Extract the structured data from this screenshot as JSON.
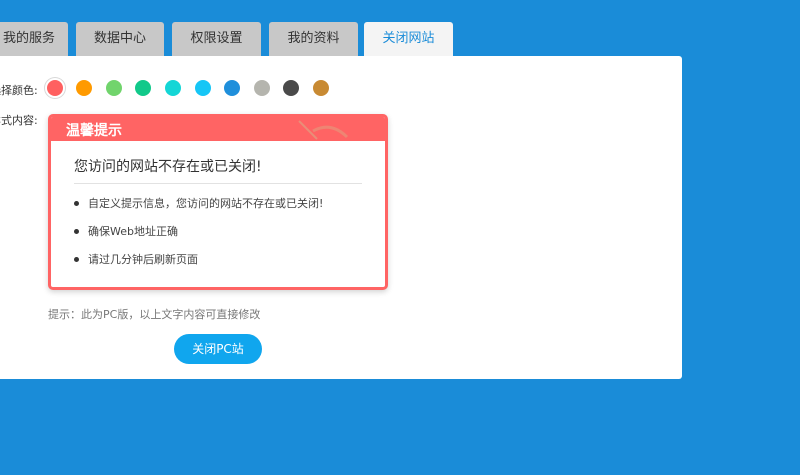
{
  "tabs": [
    {
      "label": "我的服务",
      "active": false
    },
    {
      "label": "数据中心",
      "active": false
    },
    {
      "label": "权限设置",
      "active": false
    },
    {
      "label": "我的资料",
      "active": false
    },
    {
      "label": "关闭网站",
      "active": true
    }
  ],
  "form": {
    "color_label": "选择颜色:",
    "content_label": "样式内容:"
  },
  "colors": [
    "#ff6060",
    "#ff9a00",
    "#71d46c",
    "#11c98a",
    "#14d6d6",
    "#16c6f6",
    "#1f8fdb",
    "#b5b5ae",
    "#4a4a4a",
    "#c88a33"
  ],
  "selected_color_index": 0,
  "notice": {
    "title": "温馨提示",
    "message": "您访问的网站不存在或已关闭!",
    "items": [
      "自定义提示信息，您访问的网站不存在或已关闭!",
      "确保Web地址正确",
      "请过几分钟后刷新页面"
    ]
  },
  "hint": "提示：此为PC版，以上文字内容可直接修改",
  "close_button": "关闭PC站"
}
